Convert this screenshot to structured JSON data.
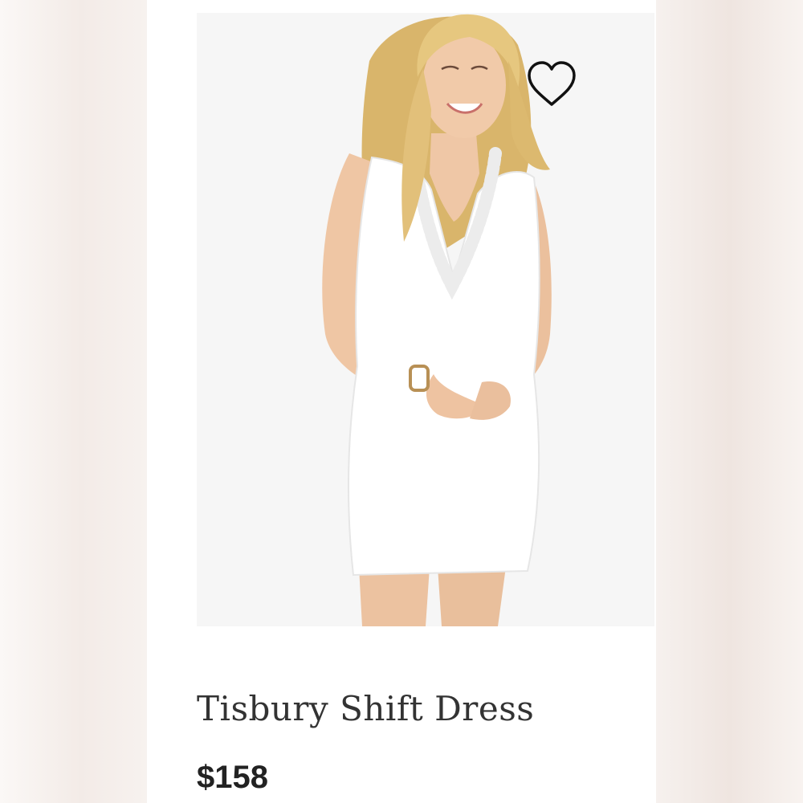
{
  "product": {
    "title": "Tisbury Shift Dress",
    "price": "$158",
    "image_icon": "product-photo-white-ruffle-shift-dress",
    "favorite_icon": "heart-outline-icon"
  },
  "colors": {
    "background": "#f4efec",
    "card": "#ffffff",
    "photo_background": "#f6f6f6",
    "dress": "#ffffff",
    "hair": "#e2c27a",
    "skin": "#efc7a6",
    "text": "#333333"
  }
}
